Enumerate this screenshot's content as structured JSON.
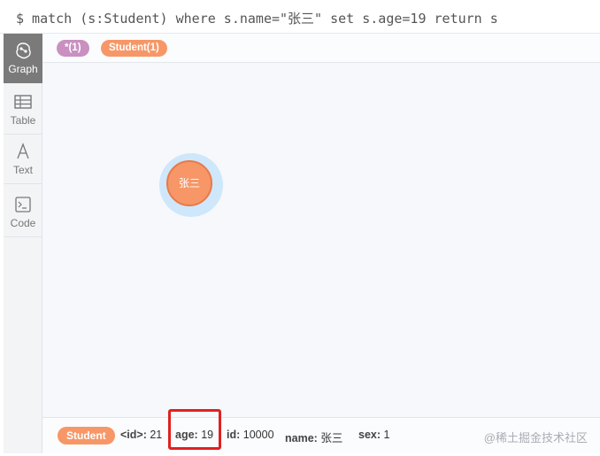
{
  "query": {
    "text": "$ match (s:Student) where s.name=\"张三\" set s.age=19 return s"
  },
  "sidebar": {
    "items": [
      {
        "label": "Graph",
        "icon": "graph-icon",
        "active": true
      },
      {
        "label": "Table",
        "icon": "table-icon",
        "active": false
      },
      {
        "label": "Text",
        "icon": "text-icon",
        "active": false
      },
      {
        "label": "Code",
        "icon": "code-icon",
        "active": false
      }
    ]
  },
  "tags": {
    "all": {
      "label": "*(1)",
      "color": "#c990c0"
    },
    "student": {
      "label": "Student(1)",
      "color": "#f79767"
    }
  },
  "graph": {
    "node": {
      "label": "张三",
      "color": "#f79767",
      "selected_ring": "#cfe7fa"
    }
  },
  "properties": {
    "label": "Student",
    "items": [
      {
        "key": "<id>:",
        "value": "21"
      },
      {
        "key": "age:",
        "value": "19"
      },
      {
        "key": "id:",
        "value": "10000"
      },
      {
        "key": "name:",
        "value": "张三"
      },
      {
        "key": "sex:",
        "value": "1"
      }
    ]
  },
  "watermark": "@稀土掘金技术社区",
  "colors": {
    "accent": "#f79767",
    "highlight_box": "#e02020"
  }
}
